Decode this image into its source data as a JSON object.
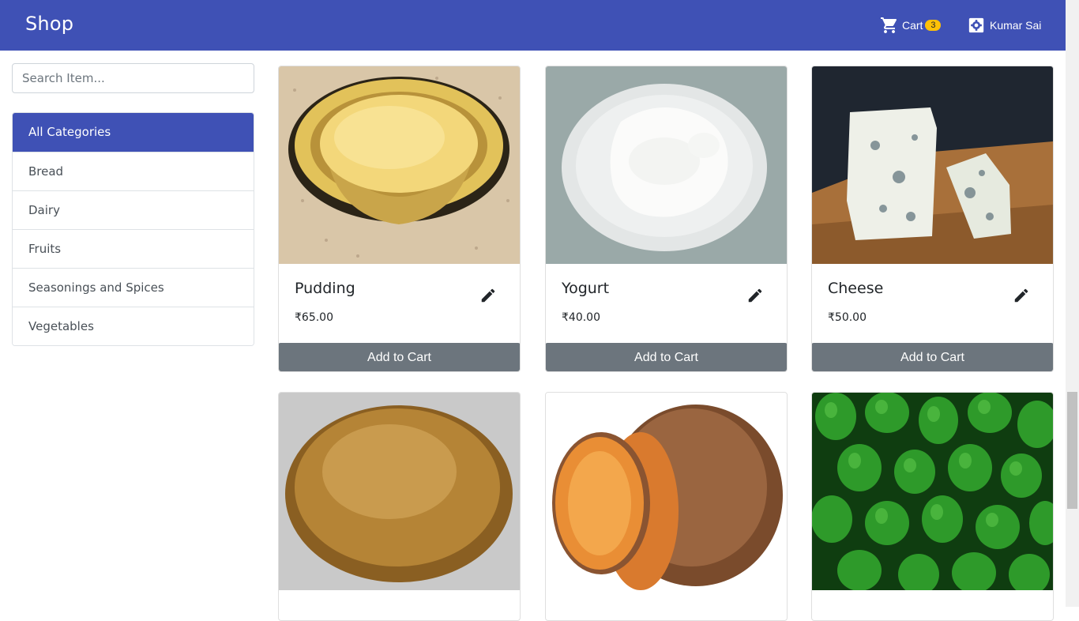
{
  "navbar": {
    "brand": "Shop",
    "cart_label": "Cart",
    "cart_count": "3",
    "user_name": "Kumar Sai",
    "color": "#3f51b5"
  },
  "sidebar": {
    "search_placeholder": "Search Item...",
    "categories": [
      {
        "label": "All Categories",
        "active": true
      },
      {
        "label": "Bread",
        "active": false
      },
      {
        "label": "Dairy",
        "active": false
      },
      {
        "label": "Fruits",
        "active": false
      },
      {
        "label": "Seasonings and Spices",
        "active": false
      },
      {
        "label": "Vegetables",
        "active": false
      }
    ]
  },
  "products": [
    {
      "name": "Pudding",
      "price": "₹65.00",
      "button": "Add to Cart",
      "image": "pudding"
    },
    {
      "name": "Yogurt",
      "price": "₹40.00",
      "button": "Add to Cart",
      "image": "yogurt"
    },
    {
      "name": "Cheese",
      "price": "₹50.00",
      "button": "Add to Cart",
      "image": "cheese"
    },
    {
      "image": "bread-bun"
    },
    {
      "image": "sweet-potato"
    },
    {
      "image": "green-peppers"
    }
  ]
}
